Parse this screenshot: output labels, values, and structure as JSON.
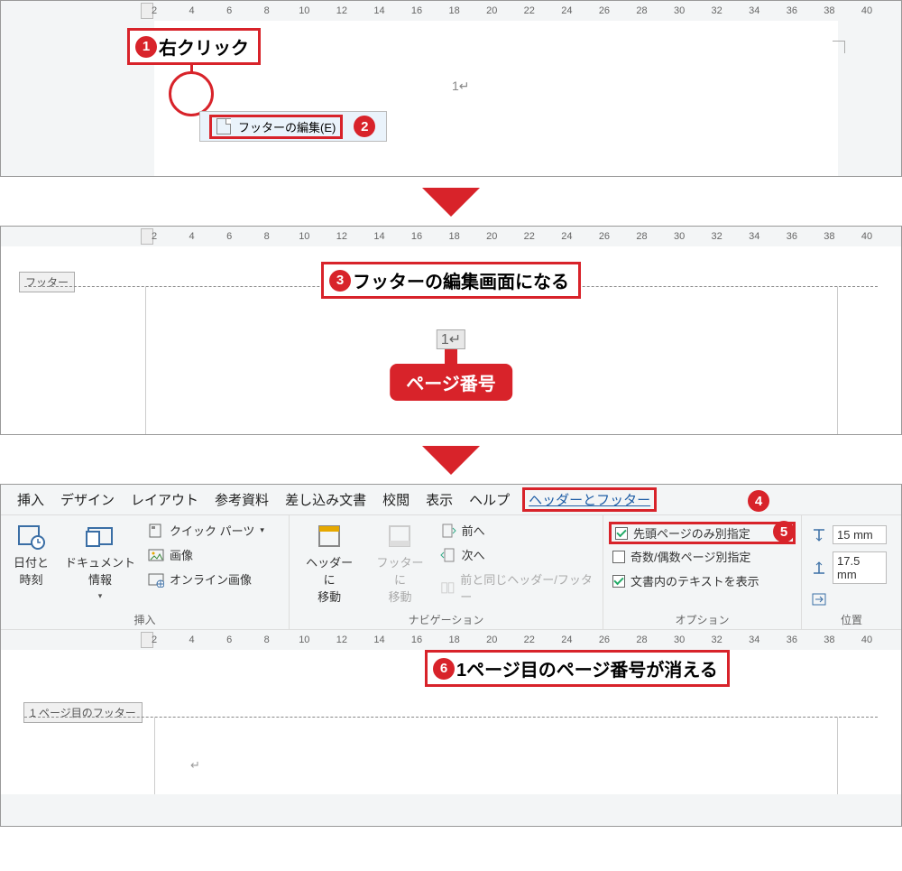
{
  "ruler_ticks": [
    2,
    4,
    6,
    8,
    10,
    12,
    14,
    16,
    18,
    20,
    22,
    24,
    26,
    28,
    30,
    32,
    34,
    36,
    38,
    40
  ],
  "panel1": {
    "callout1_text": "右クリック",
    "context_menu_item": "フッターの編集(E)",
    "page_number": "1↵"
  },
  "panel2": {
    "footer_tab_label": "フッター",
    "callout3_text": "フッターの編集画面になる",
    "page_number": "1↵",
    "page_number_label": "ページ番号"
  },
  "ribbon": {
    "tabs": [
      "挿入",
      "デザイン",
      "レイアウト",
      "参考資料",
      "差し込み文書",
      "校閲",
      "表示",
      "ヘルプ",
      "ヘッダーとフッター"
    ],
    "active_tab_index": 8,
    "group_insert_label": "挿入",
    "btn_datetime": "日付と\n時刻",
    "btn_docinfo": "ドキュメント\n情報",
    "btn_quickparts": "クイック パーツ",
    "btn_image": "画像",
    "btn_onlineimage": "オンライン画像",
    "group_nav_label": "ナビゲーション",
    "btn_gotoheader": "ヘッダーに\n移動",
    "btn_gotofooter": "フッターに\n移動",
    "btn_prev": "前へ",
    "btn_next": "次へ",
    "btn_sameasprev": "前と同じヘッダー/フッター",
    "group_options_label": "オプション",
    "opt_firstpage": "先頭ページのみ別指定",
    "opt_firstpage_checked": true,
    "opt_oddeven": "奇数/偶数ページ別指定",
    "opt_oddeven_checked": false,
    "opt_showdoc": "文書内のテキストを表示",
    "opt_showdoc_checked": true,
    "group_pos_label": "位置",
    "pos_top": "15 mm",
    "pos_bottom": "17.5 mm"
  },
  "panel3": {
    "callout6_text": "1ページ目のページ番号が消える",
    "footer_tab_label": "1 ページ目のフッター",
    "cursor_mark": "↵"
  },
  "badges": {
    "b1": "1",
    "b2": "2",
    "b3": "3",
    "b4": "4",
    "b5": "5",
    "b6": "6"
  }
}
